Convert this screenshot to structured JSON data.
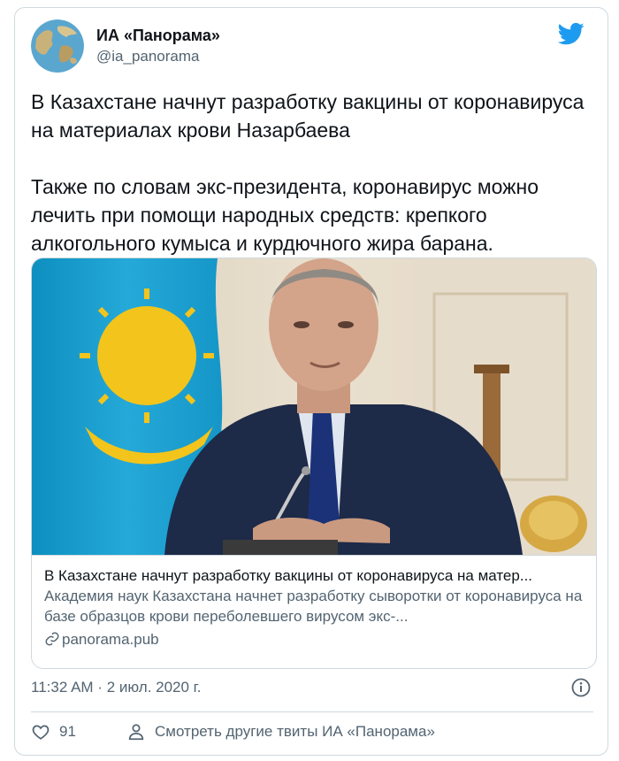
{
  "author": {
    "display_name": "ИА «Панорама»",
    "handle": "@ia_panorama",
    "avatar_icon": "globe-avatar"
  },
  "brand": {
    "icon": "twitter-bird-icon",
    "color": "#1d9bf0"
  },
  "tweet": {
    "paragraph_1": "В Казахстане начнут разработку вакцины от коронавируса на материалах крови Назарбаева",
    "paragraph_2": "Также по словам экс-президента, коронавирус можно лечить при помощи народных средств: крепкого алкогольного кумыса и курдючного жира барана."
  },
  "card": {
    "title": "В Казахстане начнут разработку вакцины от коронавируса на матер...",
    "description": "Академия наук Казахстана начнет разработку сыворотки от коронавируса на базе образцов крови переболевшего вирусом экс-...",
    "domain": "panorama.pub",
    "link_icon": "link-icon"
  },
  "meta": {
    "time": "11:32 AM",
    "separator": "·",
    "date": "2 июл. 2020 г."
  },
  "actions": {
    "like_count": "91",
    "see_more_label": "Смотреть другие твиты ИА «Панорама»"
  },
  "colors": {
    "text": "#0f1419",
    "secondary": "#536471",
    "border": "#cfd9de"
  }
}
